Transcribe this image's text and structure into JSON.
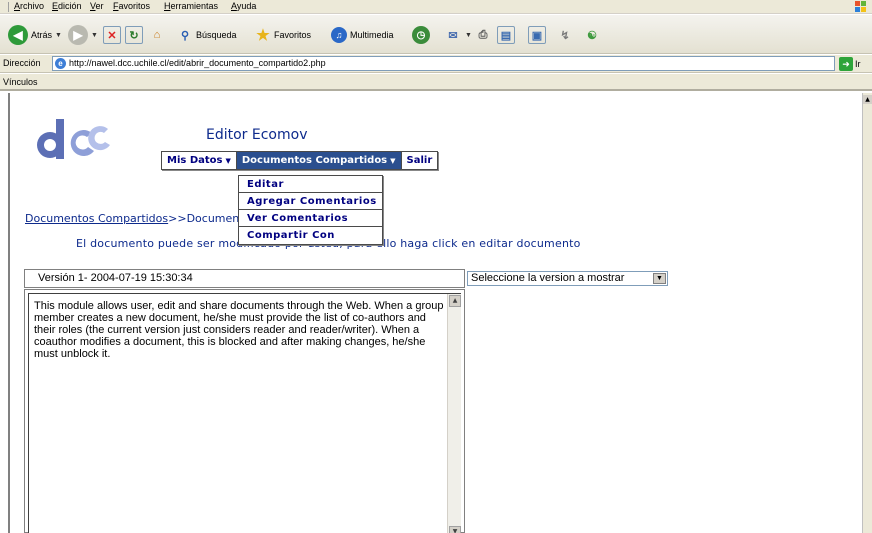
{
  "browser": {
    "menu": [
      "Archivo",
      "Edición",
      "Ver",
      "Favoritos",
      "Herramientas",
      "Ayuda"
    ],
    "toolbar": {
      "back": "Atrás",
      "search": "Búsqueda",
      "favorites": "Favoritos",
      "multimedia": "Multimedia"
    },
    "address": {
      "label": "Dirección",
      "url": "http://nawel.dcc.uchile.cl/edit/abrir_documento_compartido2.php",
      "go": "Ir"
    },
    "links_label": "Vínculos"
  },
  "page": {
    "logo_text": "dcc",
    "title": "Editor Ecomov",
    "nav": [
      {
        "label": "Mis Datos"
      },
      {
        "label": "Documentos Compartidos"
      },
      {
        "label": "Salir"
      }
    ],
    "submenu": [
      "Editar",
      "Agregar Comentarios",
      "Ver Comentarios",
      "Compartir Con"
    ],
    "breadcrumb": {
      "link": "Documentos Compartidos",
      "rest": ">>Documentos"
    },
    "info": "El documento puede ser modificado por usted, para ello haga click en editar documento",
    "version_label": "Versión 1- 2004-07-19 15:30:34",
    "version_select": "Seleccione la version a mostrar",
    "document_text": "This module allows user, edit and share documents through the Web. When a  group member creates a new document, he/she must provide the list of co-authors and their roles (the current version just considers reader and reader/writer). When a coauthor modifies a document, this is blocked and after making changes, he/she must unblock it."
  }
}
